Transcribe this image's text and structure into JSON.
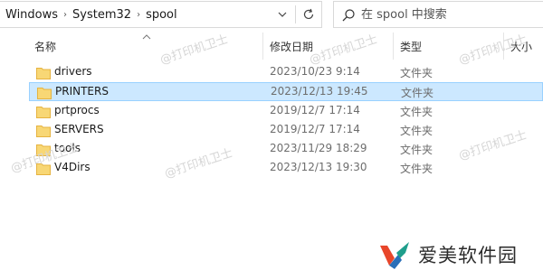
{
  "address_bar": {
    "crumbs": [
      "Windows",
      "System32",
      "spool"
    ],
    "separator_glyph": "›",
    "dropdown_icon": "chevron-down-icon",
    "refresh_icon": "refresh-icon"
  },
  "search": {
    "placeholder": "在 spool 中搜索",
    "icon": "search-icon"
  },
  "columns": {
    "name": "名称",
    "date": "修改日期",
    "type": "类型",
    "size": "大小"
  },
  "files": [
    {
      "name": "drivers",
      "date": "2023/10/23 9:14",
      "type": "文件夹",
      "selected": false
    },
    {
      "name": "PRINTERS",
      "date": "2023/12/13 19:45",
      "type": "文件夹",
      "selected": true
    },
    {
      "name": "prtprocs",
      "date": "2019/12/7 17:14",
      "type": "文件夹",
      "selected": false
    },
    {
      "name": "SERVERS",
      "date": "2019/12/7 17:14",
      "type": "文件夹",
      "selected": false
    },
    {
      "name": "tools",
      "date": "2023/11/29 18:29",
      "type": "文件夹",
      "selected": false
    },
    {
      "name": "V4Dirs",
      "date": "2023/12/13 19:30",
      "type": "文件夹",
      "selected": false
    }
  ],
  "watermark": {
    "text": "@打印机卫士",
    "brand": "爱美软件园"
  },
  "colors": {
    "selection_bg": "#cce8ff",
    "selection_border": "#99d1ff",
    "folder_yellow": "#f8d775",
    "folder_dark": "#e6b340"
  }
}
